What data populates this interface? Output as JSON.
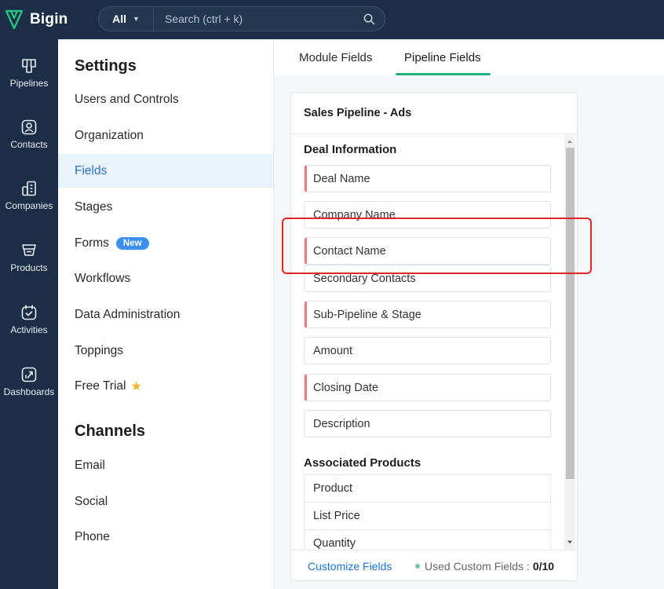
{
  "app": {
    "logo_text": "Bigin",
    "brand_color": "#26c281"
  },
  "search": {
    "scope_label": "All",
    "placeholder": "Search (ctrl + k)"
  },
  "rail": {
    "items": [
      {
        "label": "Pipelines",
        "icon": "pipelines-icon"
      },
      {
        "label": "Contacts",
        "icon": "contacts-icon"
      },
      {
        "label": "Companies",
        "icon": "companies-icon"
      },
      {
        "label": "Products",
        "icon": "products-icon"
      },
      {
        "label": "Activities",
        "icon": "activities-icon"
      },
      {
        "label": "Dashboards",
        "icon": "dashboards-icon"
      }
    ]
  },
  "settings": {
    "title": "Settings",
    "items": [
      {
        "label": "Users and Controls"
      },
      {
        "label": "Organization"
      },
      {
        "label": "Fields"
      },
      {
        "label": "Stages"
      },
      {
        "label": "Forms",
        "badge": "New"
      },
      {
        "label": "Workflows"
      },
      {
        "label": "Data Administration"
      },
      {
        "label": "Toppings"
      },
      {
        "label": "Free Trial"
      }
    ],
    "channels_title": "Channels",
    "channels": [
      {
        "label": "Email"
      },
      {
        "label": "Social"
      },
      {
        "label": "Phone"
      }
    ]
  },
  "tabs": [
    {
      "label": "Module Fields"
    },
    {
      "label": "Pipeline Fields"
    }
  ],
  "card": {
    "title": "Sales Pipeline - Ads",
    "deal_section": "Deal Information",
    "fields": [
      {
        "label": "Deal Name"
      },
      {
        "label": "Company Name"
      },
      {
        "label": "Contact Name"
      },
      {
        "label": "Secondary Contacts"
      },
      {
        "label": "Sub-Pipeline & Stage"
      },
      {
        "label": "Amount"
      },
      {
        "label": "Closing Date"
      },
      {
        "label": "Description"
      }
    ],
    "products_section": "Associated Products",
    "product_rows": [
      {
        "label": "Product"
      },
      {
        "label": "List Price"
      },
      {
        "label": "Quantity"
      }
    ],
    "footer": {
      "customize_label": "Customize Fields",
      "used_label": "Used Custom Fields :",
      "used_count": "0/10"
    }
  }
}
